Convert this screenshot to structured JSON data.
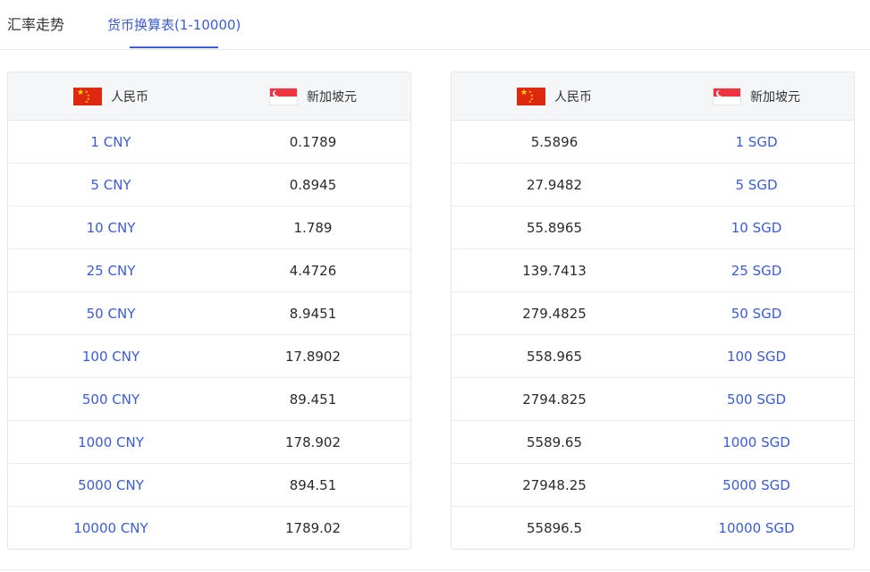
{
  "tabs": {
    "trend": "汇率走势",
    "table": "货币换算表(1-10000)"
  },
  "currencies": {
    "cny": "人民币",
    "sgd": "新加坡元"
  },
  "colors": {
    "accent": "#3b5bdb",
    "cn_flag_red": "#de2910",
    "sg_flag_red": "#ef3340"
  },
  "cny_to_sgd": [
    {
      "amount": "1 CNY",
      "result": "0.1789"
    },
    {
      "amount": "5 CNY",
      "result": "0.8945"
    },
    {
      "amount": "10 CNY",
      "result": "1.789"
    },
    {
      "amount": "25 CNY",
      "result": "4.4726"
    },
    {
      "amount": "50 CNY",
      "result": "8.9451"
    },
    {
      "amount": "100 CNY",
      "result": "17.8902"
    },
    {
      "amount": "500 CNY",
      "result": "89.451"
    },
    {
      "amount": "1000 CNY",
      "result": "178.902"
    },
    {
      "amount": "5000 CNY",
      "result": "894.51"
    },
    {
      "amount": "10000 CNY",
      "result": "1789.02"
    }
  ],
  "sgd_to_cny": [
    {
      "result": "5.5896",
      "amount": "1 SGD"
    },
    {
      "result": "27.9482",
      "amount": "5 SGD"
    },
    {
      "result": "55.8965",
      "amount": "10 SGD"
    },
    {
      "result": "139.7413",
      "amount": "25 SGD"
    },
    {
      "result": "279.4825",
      "amount": "50 SGD"
    },
    {
      "result": "558.965",
      "amount": "100 SGD"
    },
    {
      "result": "2794.825",
      "amount": "500 SGD"
    },
    {
      "result": "5589.65",
      "amount": "1000 SGD"
    },
    {
      "result": "27948.25",
      "amount": "5000 SGD"
    },
    {
      "result": "55896.5",
      "amount": "10000 SGD"
    }
  ]
}
